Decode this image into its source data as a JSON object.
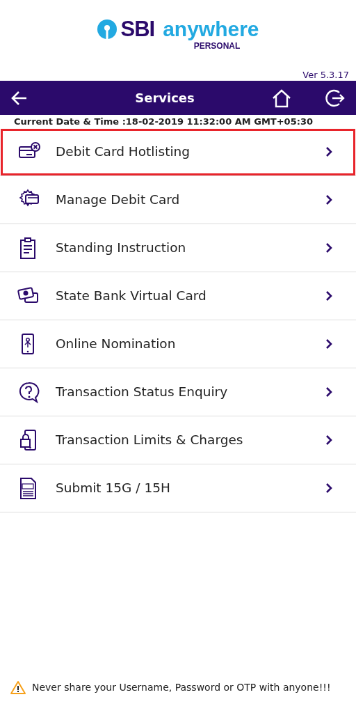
{
  "logo": {
    "brand": "SBI",
    "product": "anywhere",
    "edition": "PERSONAL"
  },
  "version": "Ver 5.3.17",
  "header": {
    "title": "Services"
  },
  "datetime": "Current Date & Time :18-02-2019 11:32:00 AM GMT+05:30",
  "services": [
    {
      "label": "Debit Card Hotlisting",
      "kind": "card-block",
      "selected": true
    },
    {
      "label": "Manage Debit Card",
      "kind": "card-gear",
      "selected": false
    },
    {
      "label": "Standing Instruction",
      "kind": "clipboard",
      "selected": false
    },
    {
      "label": "State Bank Virtual Card",
      "kind": "cards",
      "selected": false
    },
    {
      "label": "Online Nomination",
      "kind": "phone-person",
      "selected": false
    },
    {
      "label": "Transaction Status Enquiry",
      "kind": "question",
      "selected": false
    },
    {
      "label": "Transaction Limits & Charges",
      "kind": "phone-lock",
      "selected": false
    },
    {
      "label": "Submit 15G / 15H",
      "kind": "form",
      "selected": false
    }
  ],
  "footer": "Never share your Username, Password or OTP with anyone!!!"
}
